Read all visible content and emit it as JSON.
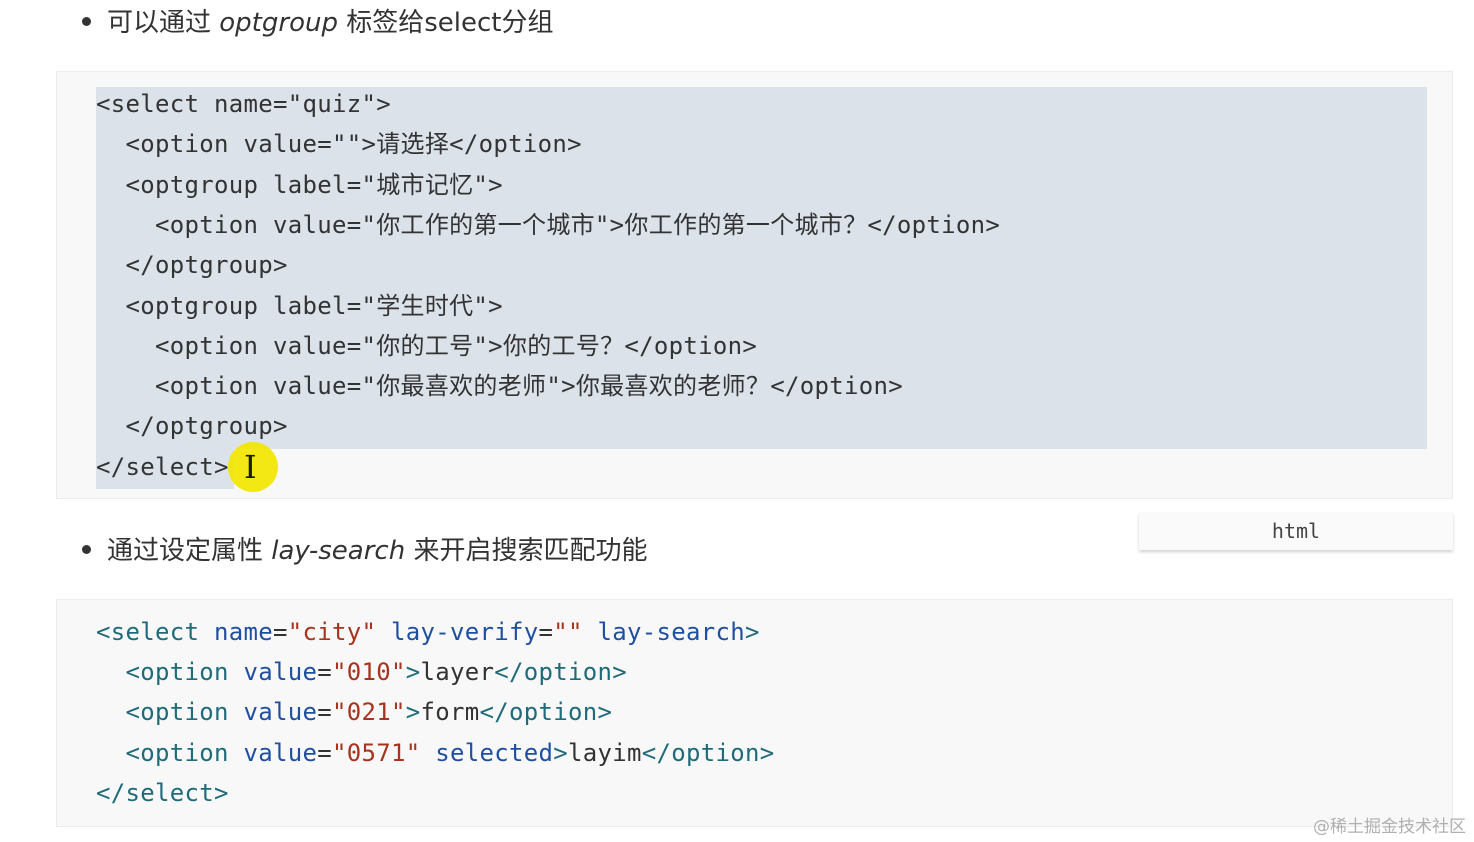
{
  "section1": {
    "bullet_prefix": "可以通过 ",
    "bullet_keyword": "optgroup",
    "bullet_suffix": " 标签给select分组",
    "code_lines": [
      "<select name=\"quiz\">",
      "  <option value=\"\">请选择</option>",
      "  <optgroup label=\"城市记忆\">",
      "    <option value=\"你工作的第一个城市\">你工作的第一个城市？</option>",
      "  </optgroup>",
      "  <optgroup label=\"学生时代\">",
      "    <option value=\"你的工号\">你的工号？</option>",
      "    <option value=\"你最喜欢的老师\">你最喜欢的老师？</option>",
      "  </optgroup>",
      "</select>"
    ]
  },
  "language_tab": "html",
  "section2": {
    "bullet_prefix": "通过设定属性 ",
    "bullet_keyword": "lay-search",
    "bullet_suffix": " 来开启搜索匹配功能",
    "code": {
      "l1_open": "<select",
      "l1_name_attr": "name",
      "l1_name_val": "\"city\"",
      "l1_verify_attr": "lay-verify",
      "l1_verify_val": "\"\"",
      "l1_search_attr": "lay-search",
      "l1_close": ">",
      "opt1_value": "\"010\"",
      "opt1_text": "layer",
      "opt2_value": "\"021\"",
      "opt2_text": "form",
      "opt3_value": "\"0571\"",
      "opt3_selected": "selected",
      "opt3_text": "layim",
      "option_open": "<option",
      "value_attr": "value",
      "option_close": "</option>",
      "close_tag": "</select>"
    }
  },
  "cursor_icon": "ibeam-cursor-icon",
  "watermark": "@稀土掘金技术社区",
  "colors": {
    "tag": "#1f6b7a",
    "attr": "#1f4fa0",
    "string": "#a8331f",
    "selection": "#dbe2ea",
    "cursor_highlight": "#f2e600"
  }
}
